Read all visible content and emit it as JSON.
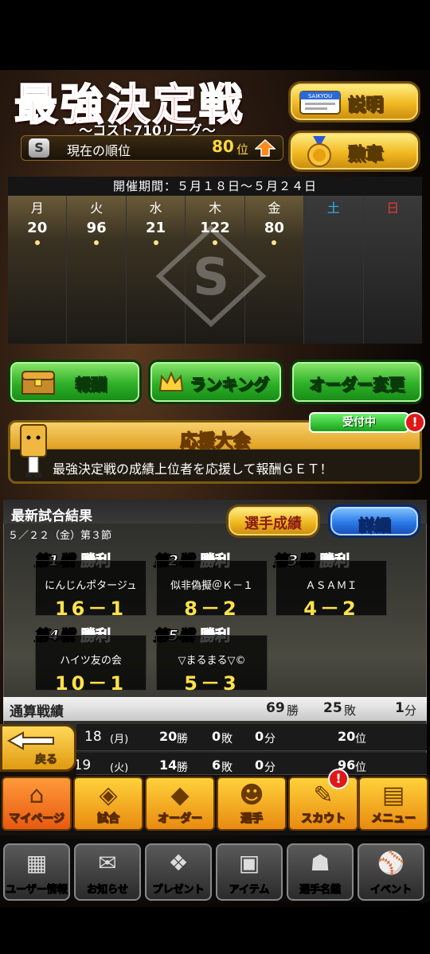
{
  "header": {
    "title": "最強決定戦",
    "subtitle": "〜コスト710リーグ〜",
    "rank_icon": "S",
    "rank_label": "現在の順位",
    "rank_value": "80",
    "rank_unit": "位",
    "help_button": "説明",
    "help_icon_text": "SAIKYOU",
    "medal_button": "勲章"
  },
  "calendar": {
    "period": "開催期間：５月１８日〜５月２４日",
    "days": [
      {
        "name": "月",
        "value": "20"
      },
      {
        "name": "火",
        "value": "96"
      },
      {
        "name": "水",
        "value": "21"
      },
      {
        "name": "木",
        "value": "122"
      },
      {
        "name": "金",
        "value": "80"
      },
      {
        "name": "土",
        "value": ""
      },
      {
        "name": "日",
        "value": ""
      }
    ],
    "emblem": "S",
    "saturday_color": "#29b6f6",
    "sunday_color": "#e53935"
  },
  "actions": {
    "reward": "報酬",
    "ranking": "ランキング",
    "order": "オーダー変更"
  },
  "support": {
    "title": "応援大会",
    "desc": "最強決定戦の成績上位者を応援して報酬ＧＥＴ！",
    "badge": "受付中",
    "alert": "!"
  },
  "results": {
    "title": "最新試合結果",
    "date": "５／２２（金）第３節",
    "stats_button": "選手成績",
    "detail_button": "詳細",
    "games": [
      {
        "label": "第1戦",
        "result": "勝利",
        "opponent": "にんじんポタージュ",
        "score": "16－1"
      },
      {
        "label": "第2戦",
        "result": "勝利",
        "opponent": "似非偽擬＠Ｋ－１",
        "score": "8－2"
      },
      {
        "label": "第3戦",
        "result": "勝利",
        "opponent": "ＡＳＡＭＩ",
        "score": "4－2"
      },
      {
        "label": "第4戦",
        "result": "勝利",
        "opponent": "ハイツ友の会",
        "score": "10－1"
      },
      {
        "label": "第5戦",
        "result": "勝利",
        "opponent": "▽まるまる▽©",
        "score": "5－3"
      }
    ]
  },
  "totals": {
    "label": "通算戦績",
    "wins": "69",
    "wins_unit": "勝",
    "losses": "25",
    "losses_unit": "敗",
    "draws": "1",
    "draws_unit": "分"
  },
  "daily": [
    {
      "day": "18",
      "dow": "(月)",
      "wins": "20",
      "wins_unit": "勝",
      "losses": "0",
      "losses_unit": "敗",
      "draws": "0",
      "draws_unit": "分",
      "rank": "20",
      "rank_unit": "位"
    },
    {
      "day": "5/19",
      "dow": "(火)",
      "wins": "14",
      "wins_unit": "勝",
      "losses": "6",
      "losses_unit": "敗",
      "draws": "0",
      "draws_unit": "分",
      "rank": "96",
      "rank_unit": "位"
    }
  ],
  "back_button": "戻る",
  "nav_main": [
    {
      "label": "マイページ",
      "icon": "home-icon"
    },
    {
      "label": "試合",
      "icon": "stadium-icon"
    },
    {
      "label": "オーダー",
      "icon": "field-icon"
    },
    {
      "label": "選手",
      "icon": "player-icon"
    },
    {
      "label": "スカウト",
      "icon": "scout-icon"
    },
    {
      "label": "メニュー",
      "icon": "menu-icon"
    }
  ],
  "scout_alert": "!",
  "nav_sub": [
    {
      "label": "ユーザー情報",
      "icon": "user-info-icon"
    },
    {
      "label": "お知らせ",
      "icon": "notice-icon"
    },
    {
      "label": "プレゼント",
      "icon": "present-icon"
    },
    {
      "label": "アイテム",
      "icon": "item-icon"
    },
    {
      "label": "選手名鑑",
      "icon": "player-book-icon"
    },
    {
      "label": "イベント",
      "icon": "event-icon"
    }
  ],
  "colors": {
    "accent_gold": "#f0b820",
    "green": "#2eb028",
    "red": "#e01818",
    "score_yellow": "#ffe24a"
  }
}
